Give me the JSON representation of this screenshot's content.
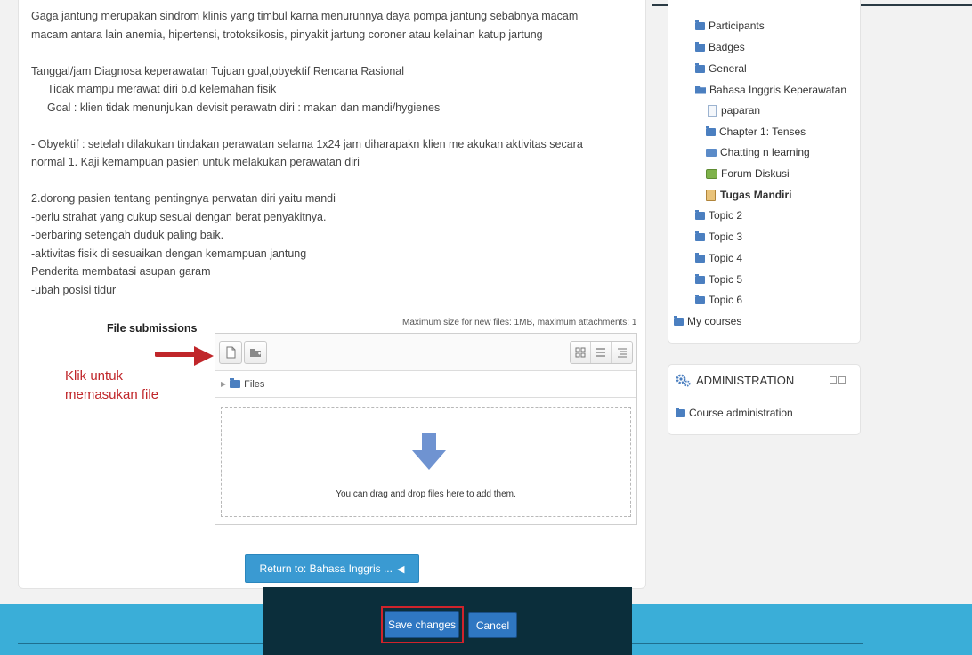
{
  "essay": {
    "lines": [
      "Gaga jantung merupakan sindrom klinis yang timbul karna menurunnya daya pompa jantung sebabnya macam",
      "macam antara lain anemia, hipertensi, trotoksikosis, pinyakit jartung coroner atau kelainan katup jartung",
      "",
      "Tanggal/jam    Diagnosa keperawatan    Tujuan goal,obyektif    Rencana    Rasional",
      "Tidak mampu merawat diri b.d kelemahan fisik",
      "Goal : klien tidak menunjukan devisit perawatn diri : makan dan mandi/hygienes",
      "",
      "- Obyektif : setelah dilakukan tindakan perawatan selama 1x24 jam diharapakn klien me akukan aktivitas secara",
      "normal    1. Kaji kemampuan pasien untuk melakukan perawatan diri",
      "",
      "2.dorong pasien tentang pentingnya perwatan diri yaitu mandi",
      "-perlu strahat yang cukup sesuai dengan berat penyakitnya.",
      "-berbaring setengah duduk paling baik.",
      "-aktivitas fisik di sesuaikan dengan kemampuan jantung",
      "Penderita membatasi asupan garam",
      "-ubah posisi tidur"
    ]
  },
  "filepicker": {
    "label": "File submissions",
    "max_size_text": "Maximum size for new files: 1MB, maximum attachments: 1",
    "path_label": "Files",
    "drop_text": "You can drag and drop files here to add them."
  },
  "annotation": {
    "line1": "Klik untuk",
    "line2": "memasukan file"
  },
  "return_button": {
    "label": "Return to: Bahasa Inggris ...",
    "icon": "◀"
  },
  "nav": {
    "participants": "Participants",
    "badges": "Badges",
    "general": "General",
    "course": "Bahasa Inggris Keperawatan",
    "items": [
      "paparan",
      "Chapter 1: Tenses",
      "Chatting n learning",
      "Forum Diskusi",
      "Tugas Mandiri"
    ],
    "topics": [
      "Topic 2",
      "Topic 3",
      "Topic 4",
      "Topic 5",
      "Topic 6"
    ],
    "my_courses": "My courses"
  },
  "admin": {
    "title": "ADMINISTRATION",
    "item": "Course administration"
  },
  "actions": {
    "save": "Save changes",
    "cancel": "Cancel"
  },
  "colors": {
    "accent": "#3a9ad2",
    "footer": "#3aaed8",
    "action_bar": "#0b2e3b",
    "highlight": "#d0232b",
    "annotation": "#c0262a"
  }
}
